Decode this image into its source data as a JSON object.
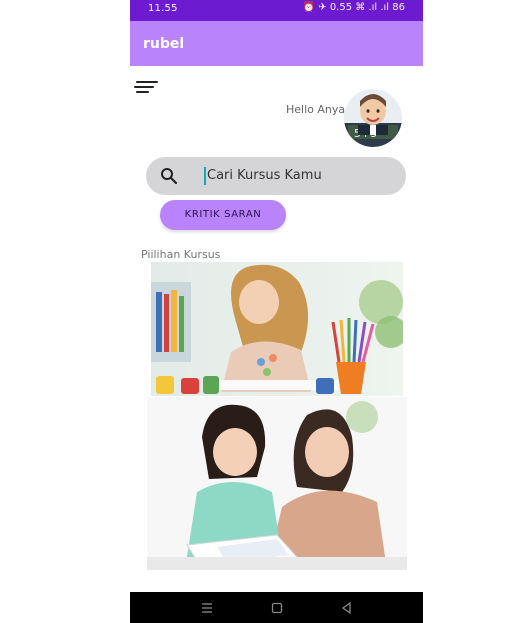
{
  "status_bar": {
    "time": "11.55",
    "icons": "⏰ ✈ 0.55 ⌘ .ıl .ıl 86"
  },
  "app_bar": {
    "title": "rubel",
    "color": "#b983fb"
  },
  "greeting": "Hello Anya",
  "search": {
    "placeholder": "Cari Kursus Kamu"
  },
  "kritik_button": {
    "label": "KRITIK SARAN"
  },
  "section": {
    "label": "Piilihan Kursus"
  },
  "icons": {
    "menu": "menu-icon",
    "search": "search-icon",
    "nav_menu": "recent-apps-icon",
    "nav_home": "home-icon",
    "nav_back": "back-icon"
  },
  "colors": {
    "status_bar": "#6c1bd1",
    "accent": "#b983fb",
    "search_bg": "#d5d5d8"
  }
}
